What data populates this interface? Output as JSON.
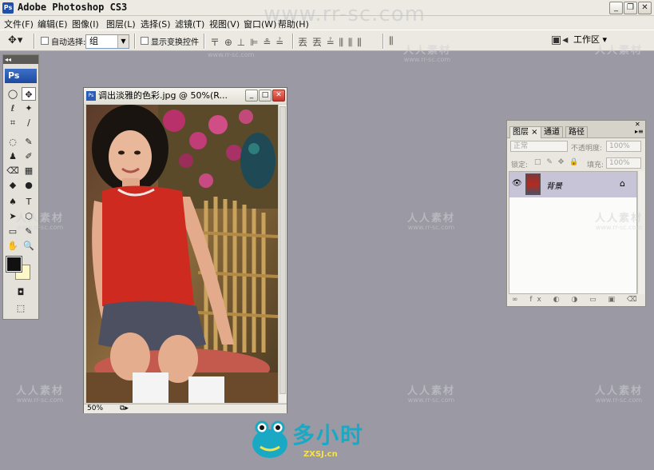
{
  "app": {
    "title": "Adobe Photoshop CS3",
    "icon_text": "Ps",
    "window_buttons": [
      "_",
      "❐",
      "✕"
    ]
  },
  "menu": [
    "文件(F)",
    "编辑(E)",
    "图像(I)",
    "图层(L)",
    "选择(S)",
    "滤镜(T)",
    "视图(V)",
    "窗口(W)",
    "帮助(H)"
  ],
  "options": {
    "auto_select_label": "自动选择:",
    "auto_select_value": "组",
    "show_transform_label": "显示变换控件",
    "align_icons": "〒 ⊕ ⊥ ⊫ ≗ ≟",
    "distribute_icons": "丟 丟 ≟ ⫼ ⫼ ⫼",
    "extra_icon": "⫼",
    "workspace_label": "工作区 ▾"
  },
  "toolbox": {
    "logo": "Ps",
    "collapse": "◂◂",
    "tools": [
      "◯",
      "✥",
      "ℓ",
      "✦",
      "⌗",
      "∕",
      "◌",
      "✎",
      "♟",
      "✐",
      "⌫",
      "▦",
      "◆",
      "●",
      "♠",
      "T",
      "➤",
      "⬡",
      "▭",
      "✎",
      "✋",
      "🔍",
      "◘",
      "⬚"
    ]
  },
  "document": {
    "title": "调出淡雅的色彩.jpg @ 50%(R...",
    "icon_text": "Ps",
    "zoom": "50%",
    "buttons": [
      "_",
      "□",
      "✕"
    ]
  },
  "layers_panel": {
    "tabs": [
      "图层 ×",
      "通道",
      "路径"
    ],
    "blend_mode": "正常",
    "opacity_label": "不透明度:",
    "opacity_value": "100%",
    "lock_label": "锁定:",
    "lock_icons": "□ ✎ ✥ 🔒",
    "fill_label": "填充:",
    "fill_value": "100%",
    "layer_name": "背景",
    "eye": "👁",
    "lock": "⌂",
    "bottom_icons": "∞ fx ◐ ◑ ▭ ▣ ⌫"
  },
  "watermark": {
    "top_url": "www.rr-sc.com",
    "cn": "人人素材",
    "url": "www.rr-sc.com"
  },
  "brand_logo": {
    "text": "多小时",
    "sub": "ZXSJ.cn"
  }
}
